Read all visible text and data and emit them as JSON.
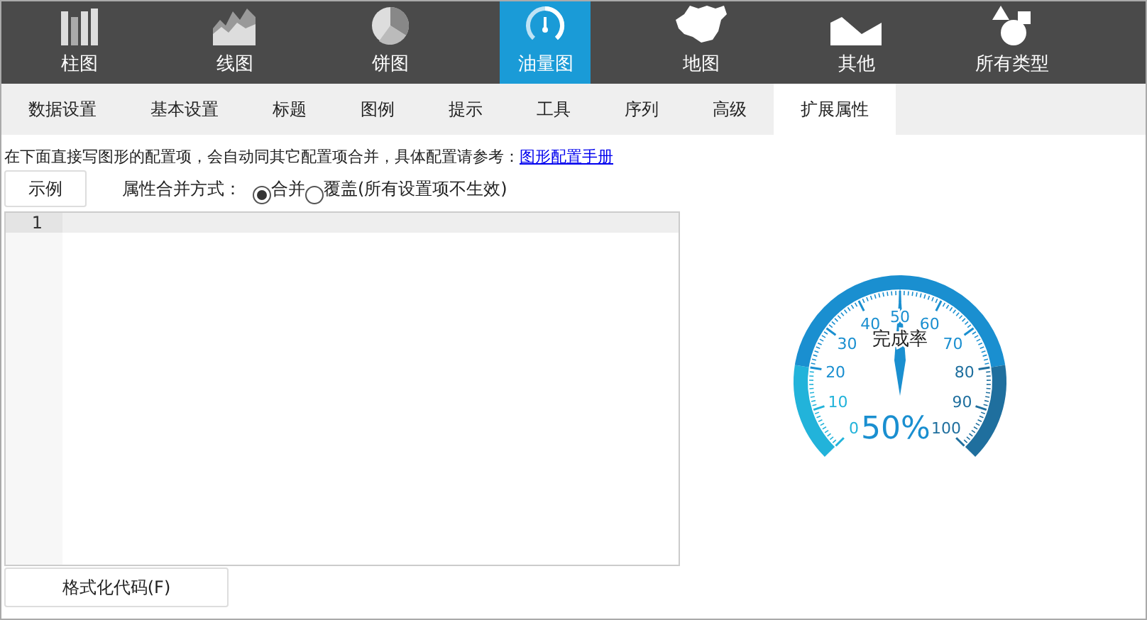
{
  "toolbar": [
    {
      "label": "柱图",
      "kind": "bar",
      "selected": false
    },
    {
      "label": "线图",
      "kind": "line",
      "selected": false
    },
    {
      "label": "饼图",
      "kind": "pie",
      "selected": false
    },
    {
      "label": "油量图",
      "kind": "gauge",
      "selected": true
    },
    {
      "label": "地图",
      "kind": "map",
      "selected": false
    },
    {
      "label": "其他",
      "kind": "other",
      "selected": false
    },
    {
      "label": "所有类型",
      "kind": "all",
      "selected": false
    }
  ],
  "tabs": [
    {
      "label": "数据设置",
      "selected": false
    },
    {
      "label": "基本设置",
      "selected": false
    },
    {
      "label": "标题",
      "selected": false
    },
    {
      "label": "图例",
      "selected": false
    },
    {
      "label": "提示",
      "selected": false
    },
    {
      "label": "工具",
      "selected": false
    },
    {
      "label": "序列",
      "selected": false
    },
    {
      "label": "高级",
      "selected": false
    },
    {
      "label": "扩展属性",
      "selected": true
    }
  ],
  "instructions": {
    "text": "在下面直接写图形的配置项，会自动同其它配置项合并，具体配置请参考：",
    "link": "图形配置手册"
  },
  "example_button": "示例",
  "merge_mode": {
    "label": "属性合并方式：",
    "options": [
      {
        "label": "合并",
        "selected": true
      },
      {
        "label": "覆盖(所有设置项不生效)",
        "selected": false
      }
    ]
  },
  "editor": {
    "line_numbers": [
      "1"
    ]
  },
  "format_button": "格式化代码(F)",
  "gauge": {
    "title": "完成率",
    "value_text": "50%",
    "level": 0.5,
    "scale_labels": [
      "0",
      "10",
      "20",
      "30",
      "40",
      "50",
      "60",
      "70",
      "80",
      "90",
      "100"
    ]
  }
}
